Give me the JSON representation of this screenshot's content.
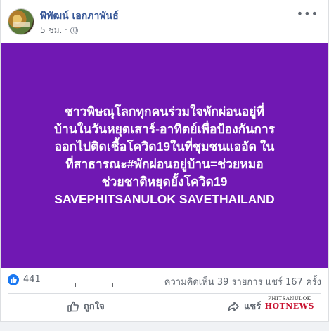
{
  "post": {
    "author": "พิพัฒน์ เอกภาพันธ์",
    "time": "5 ชม.",
    "separator": "·",
    "more_icon": "more-horiz-icon",
    "image_text": "ชาวพิษณุโลกทุกคนร่วมใจพักผ่อนอยู่ที่\nบ้านในวันหยุดเสาร์-อาทิตย์เพื่อป้องกันการ\nออกไปติดเชื้อโควิด19ในที่ชุมชนแออัด ใน\nที่สาธารณะ#พักผ่อนอยู่บ้าน=ช่วยหมอ\nช่วยชาติหยุดยั้งโควิด19\nSAVEPHITSANULOK SAVETHAILAND",
    "image_bg": "#7018b3"
  },
  "stats": {
    "likes": "441",
    "comments": "ความคิดเห็น 39 รายการ",
    "shares": "แชร์ 167 ครั้ง"
  },
  "actions": {
    "like_label": "ถูกใจ",
    "share_label": "แชร์"
  },
  "watermark": {
    "top": "PHITSANULOK",
    "bottom": "HOTNEWS"
  },
  "colors": {
    "accent": "#1877f2",
    "author": "#385898",
    "watermark_red": "#c8102e"
  }
}
